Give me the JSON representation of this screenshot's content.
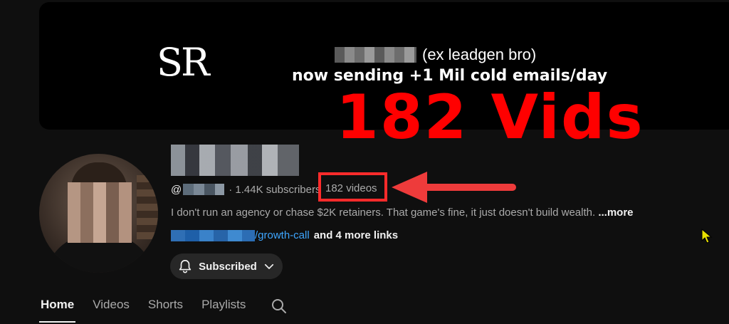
{
  "banner": {
    "logo_text": "SR",
    "line1": "(ex leadgen bro)",
    "line2": "now sending +1 Mil cold emails/day"
  },
  "overlay": {
    "title": "182 Vids",
    "color": "#ff0000"
  },
  "channel": {
    "handle_prefix": "@",
    "subscribers": "· 1.44K subscribers",
    "videos": "182 videos",
    "description": "I don't run an agency or chase $2K retainers. That game's fine, it just doesn't build wealth.",
    "description_more": " ...more",
    "link_text": "/growth-call",
    "more_links": "and 4 more links",
    "subscribed_label": "Subscribed"
  },
  "tabs": [
    {
      "label": "Home",
      "active": true
    },
    {
      "label": "Videos",
      "active": false
    },
    {
      "label": "Shorts",
      "active": false
    },
    {
      "label": "Playlists",
      "active": false
    }
  ],
  "icons": {
    "bell": "bell-icon",
    "chevron": "chevron-down-icon",
    "search": "search-icon",
    "arrow": "arrow-left-icon",
    "cursor": "mouse-cursor-icon"
  },
  "colors": {
    "background": "#0f0f0f",
    "link": "#3ea6ff",
    "highlight": "#ff2b2b"
  }
}
